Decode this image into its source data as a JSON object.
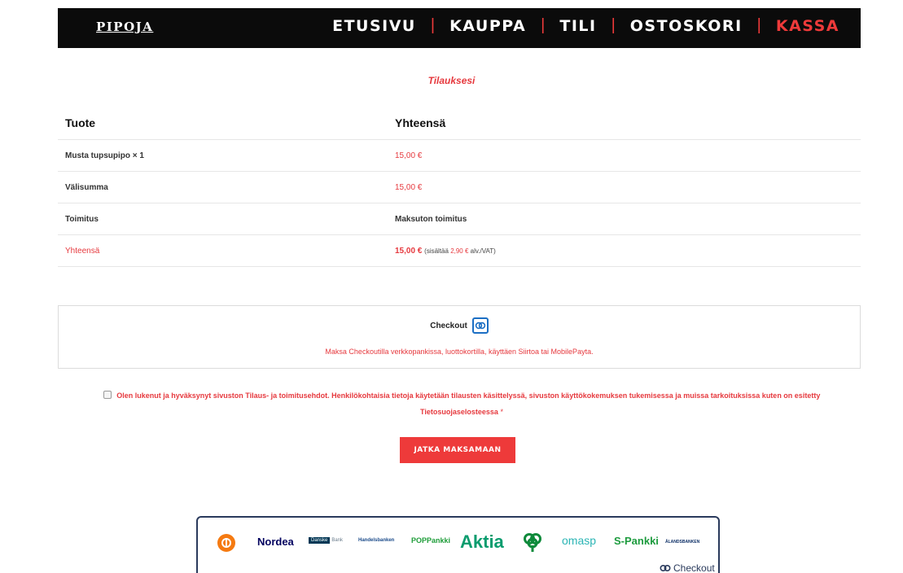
{
  "header": {
    "logo": "PIPOJA",
    "nav": [
      {
        "label": "ETUSIVU",
        "active": false
      },
      {
        "label": "KAUPPA",
        "active": false
      },
      {
        "label": "TILI",
        "active": false
      },
      {
        "label": "OSTOSKORI",
        "active": false
      },
      {
        "label": "KASSA",
        "active": true
      }
    ],
    "separator": "|"
  },
  "order": {
    "title": "Tilauksesi",
    "columns": {
      "product": "Tuote",
      "total": "Yhteensä"
    },
    "item": {
      "name": "Musta tupsupipo",
      "qty": "× 1",
      "price": "15,00 €"
    },
    "subtotal": {
      "label": "Välisumma",
      "value": "15,00 €"
    },
    "shipping": {
      "label": "Toimitus",
      "value": "Maksuton toimitus"
    },
    "total": {
      "label": "Yhteensä",
      "value": "15,00 €",
      "vat_prefix": "(sisältää",
      "vat_amount": "2,90 €",
      "vat_suffix": "alv./VAT)"
    }
  },
  "payment": {
    "method_name": "Checkout",
    "description": "Maksa Checkoutilla verkkopankissa, luottokortilla, käyttäen Siirtoa tai MobilePayta."
  },
  "terms": {
    "text": "Olen lukenut ja hyväksynyt sivuston Tilaus- ja toimitusehdot. Henkilökohtaisia tietoja käytetään tilausten käsittelyssä, sivuston käyttökokemuksen tukemisessa ja muissa tarkoituksissa kuten on esitetty Tietosuojaselosteessa",
    "required_mark": "*",
    "checked": false
  },
  "pay_button": {
    "label": "JATKA MAKSAMAAN"
  },
  "banks": {
    "nordea": "Nordea",
    "danske_block": "Danske",
    "danske_text": "Bank",
    "handelsbanken": "Handelsbanken",
    "pop": "POPPankki",
    "aktia": "Aktia",
    "omasp": "omasp",
    "spankki": "S-Pankki",
    "alandsbanken": "ÅLANDSBANKEN",
    "checkout": "Checkout"
  },
  "colors": {
    "accent": "#ee3a3a",
    "nav_bg": "#0b0b0b",
    "checkout_blue": "#1c6fc4"
  }
}
